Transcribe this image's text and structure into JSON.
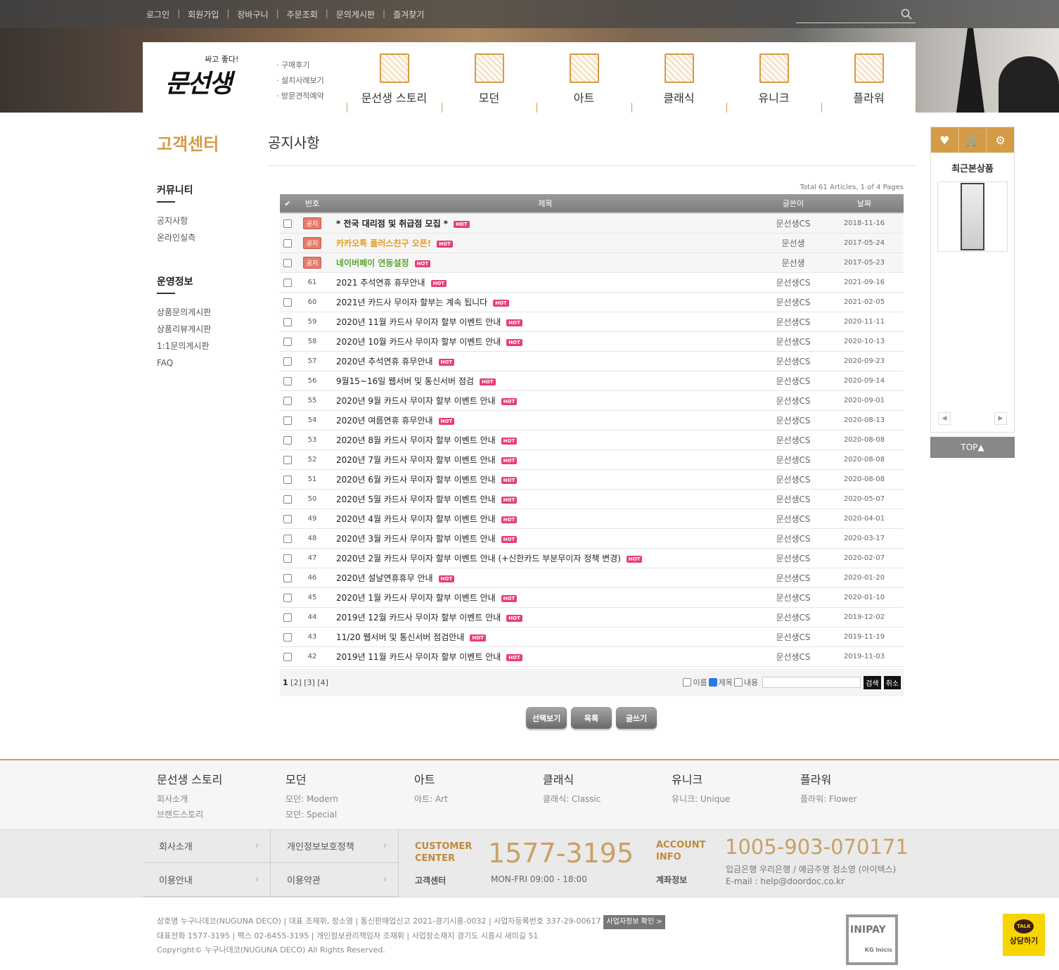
{
  "topbar": {
    "links": [
      "로그인",
      "회원가입",
      "장바구니",
      "주문조회",
      "문의게시판",
      "즐겨찾기"
    ]
  },
  "logo": {
    "small": "싸고 좋다!",
    "big": "문선생"
  },
  "header_sublinks": [
    "· 구매후기",
    "· 설치사례보기",
    "· 방문견적예약"
  ],
  "main_nav": [
    "문선생 스토리",
    "모던",
    "아트",
    "클래식",
    "유니크",
    "플라워"
  ],
  "sidebar": {
    "title": "고객센터",
    "sections": [
      {
        "heading": "커뮤니티",
        "items": [
          "공지사항",
          "온라인실측"
        ]
      },
      {
        "heading": "운영정보",
        "items": [
          "상품문의게시판",
          "상품리뷰게시판",
          "1:1문의게시판",
          "FAQ"
        ]
      }
    ]
  },
  "page": {
    "title": "공지사항",
    "total": "Total 61 Articles, 1 of 4 Pages"
  },
  "table": {
    "headers": {
      "check": "✔",
      "num": "번호",
      "subject": "제목",
      "name": "글쓴이",
      "date": "날짜"
    },
    "hot_label": "HOT",
    "notice_label": "공지",
    "rows": [
      {
        "num": "공지",
        "subject": "* 전국 대리점 및 취급점 모집 *",
        "name": "문선생CS",
        "date": "2018-11-16",
        "notice": true,
        "color": "#222222"
      },
      {
        "num": "공지",
        "subject": "카카오톡 플러스친구 오픈!",
        "name": "문선생",
        "date": "2017-05-24",
        "notice": true,
        "color": "#e69a1e"
      },
      {
        "num": "공지",
        "subject": "네이버페이 연동설정",
        "name": "문선생",
        "date": "2017-05-23",
        "notice": true,
        "color": "#5aa531"
      },
      {
        "num": "61",
        "subject": "2021 추석연휴 휴무안내",
        "name": "문선생CS",
        "date": "2021-09-16"
      },
      {
        "num": "60",
        "subject": "2021년 카드사 무이자 할부는 계속 됩니다",
        "name": "문선생CS",
        "date": "2021-02-05"
      },
      {
        "num": "59",
        "subject": "2020년 11월 카드사 무이자 할부 이벤트 안내",
        "name": "문선생CS",
        "date": "2020-11-11"
      },
      {
        "num": "58",
        "subject": "2020년 10월 카드사 무이자 할부 이벤트 안내",
        "name": "문선생CS",
        "date": "2020-10-13"
      },
      {
        "num": "57",
        "subject": "2020년 추석연휴 휴무안내",
        "name": "문선생CS",
        "date": "2020-09-23"
      },
      {
        "num": "56",
        "subject": "9월15~16일 웹서버 및 통신서버 점검",
        "name": "문선생CS",
        "date": "2020-09-14"
      },
      {
        "num": "55",
        "subject": "2020년 9월 카드사 무이자 할부 이벤트 안내",
        "name": "문선생CS",
        "date": "2020-09-01"
      },
      {
        "num": "54",
        "subject": "2020년 여름연휴 휴무안내",
        "name": "문선생CS",
        "date": "2020-08-13"
      },
      {
        "num": "53",
        "subject": "2020년 8월 카드사 무이자 할부 이벤트 안내",
        "name": "문선생CS",
        "date": "2020-08-08"
      },
      {
        "num": "52",
        "subject": "2020년 7월 카드사 무이자 할부 이벤트 안내",
        "name": "문선생CS",
        "date": "2020-08-08"
      },
      {
        "num": "51",
        "subject": "2020년 6월 카드사 무이자 할부 이벤트 안내",
        "name": "문선생CS",
        "date": "2020-08-08"
      },
      {
        "num": "50",
        "subject": "2020년 5월 카드사 무이자 할부 이벤트 안내",
        "name": "문선생CS",
        "date": "2020-05-07"
      },
      {
        "num": "49",
        "subject": "2020년 4월 카드사 무이자 할부 이벤트 안내",
        "name": "문선생CS",
        "date": "2020-04-01"
      },
      {
        "num": "48",
        "subject": "2020년 3월 카드사 무이자 할부 이벤트 안내",
        "name": "문선생CS",
        "date": "2020-03-17"
      },
      {
        "num": "47",
        "subject": "2020년 2월 카드사 무이자 할부 이벤트 안내 (+신한카드 부분무이자 정책 변경)",
        "name": "문선생CS",
        "date": "2020-02-07"
      },
      {
        "num": "46",
        "subject": "2020년 설날연휴휴무 안내",
        "name": "문선생CS",
        "date": "2020-01-20"
      },
      {
        "num": "45",
        "subject": "2020년 1월 카드사 무이자 할부 이벤트 안내",
        "name": "문선생CS",
        "date": "2020-01-10"
      },
      {
        "num": "44",
        "subject": "2019년 12월 카드사 무이자 할부 이벤트 안내",
        "name": "문선생CS",
        "date": "2019-12-02"
      },
      {
        "num": "43",
        "subject": "11/20 웹서버 및 통신서버 점검안내",
        "name": "문선생CS",
        "date": "2019-11-19"
      },
      {
        "num": "42",
        "subject": "2019년 11월 카드사 무이자 할부 이벤트 안내",
        "name": "문선생CS",
        "date": "2019-11-03"
      }
    ]
  },
  "pager": {
    "current": "1",
    "pages": [
      "[2]",
      "[3]",
      "[4]"
    ]
  },
  "search": {
    "opt_name": "이름",
    "opt_subject": "제목",
    "opt_content": "내용",
    "search_btn": "검색",
    "cancel_btn": "취소"
  },
  "actions": {
    "select_view": "선택보기",
    "list": "목록",
    "write": "글쓰기"
  },
  "quick": {
    "recent": "최근본상품",
    "prev": "◀",
    "next": "▶",
    "top": "TOP▲"
  },
  "footer_cats": [
    {
      "title": "문선생 스토리",
      "links": [
        "회사소개",
        "브랜드스토리"
      ]
    },
    {
      "title": "모던",
      "links": [
        "모던: Modern",
        "모던: Special"
      ]
    },
    {
      "title": "아트",
      "links": [
        "아트: Art"
      ]
    },
    {
      "title": "클래식",
      "links": [
        "클래식: Classic"
      ]
    },
    {
      "title": "유니크",
      "links": [
        "유니크: Unique"
      ]
    },
    {
      "title": "플라워",
      "links": [
        "플라워: Flower"
      ]
    }
  ],
  "footer_links": [
    "회사소개",
    "개인정보보호정책",
    "이용안내",
    "이용약관"
  ],
  "customer": {
    "label1": "CUSTOMER",
    "label2": "CENTER",
    "sub": "고객센터",
    "phone": "1577-3195",
    "hours": "MON-FRI 09:00 - 18:00"
  },
  "account": {
    "label1": "ACCOUNT",
    "label2": "INFO",
    "sub": "계좌정보",
    "number": "1005-903-070171",
    "bank": "입금은행 우리은행 / 예금주명 정소영 (아이텍스)",
    "email": "E-mail : help@doordoc.co.kr"
  },
  "company": {
    "line1": "상호명 누구나데코(NUGUNA DECO) | 대표 조재휘, 정소영 | 통신판매업신고 2021-경기시흥-0032 | 사업자등록번호 337-29-00617",
    "biz_btn": "사업자정보 확인 >",
    "line2": "대표전화 1577-3195 | 팩스 02-6455-3195 | 개인정보관리책임자 조재휘 | 사업장소재지 경기도 시흥시 새미길 51",
    "line3": "Copyright© 누구나데코(NUGUNA DECO) All Rights Reserved."
  },
  "inipay": {
    "name": "INIPAY",
    "sub": "KG Inicis"
  },
  "kakao": {
    "talk": "TALK",
    "label": "상담하기"
  },
  "colors": {
    "accent": "#d49b48",
    "hot": "#e93d79",
    "notice_badge": "#e87a6a"
  }
}
